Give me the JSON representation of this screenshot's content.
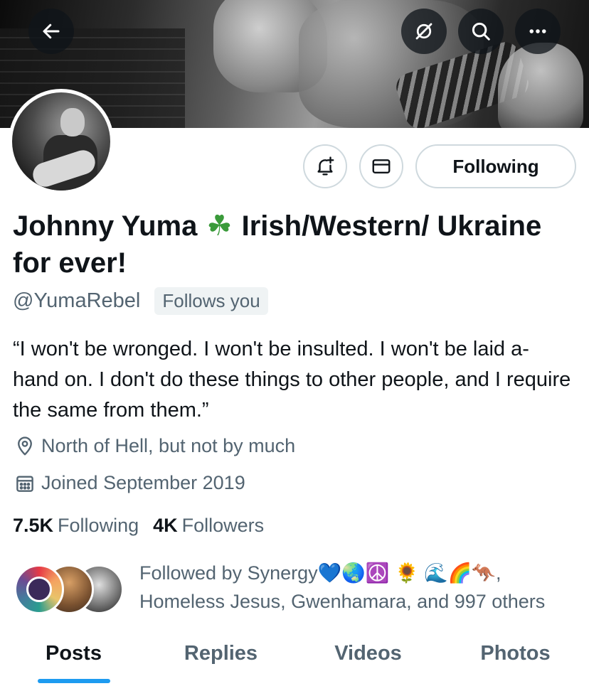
{
  "header": {
    "back_icon": "arrow-left-icon",
    "icons": [
      "no-sync-icon",
      "search-icon",
      "more-icon"
    ]
  },
  "actions": {
    "notify_icon": "bell-plus-icon",
    "message_icon": "envelope-icon",
    "following_label": "Following"
  },
  "profile": {
    "name_part1": "Johnny Yuma",
    "name_emoji": "☘",
    "name_part2": "Irish/Western/ Ukraine for ever!",
    "handle": "@YumaRebel",
    "follows_you": "Follows you",
    "bio": "“I won't be wronged. I won't be insulted. I won't be laid a-hand on. I don't do these things to other people, and I require the same from them.”",
    "location": "North of Hell, but not by much",
    "joined": "Joined September 2019",
    "following_count": "7.5K",
    "following_label": "Following",
    "followers_count": "4K",
    "followers_label": "Followers",
    "followed_by": "Followed by Synergy💙🌏☮️ 🌻 🌊🌈🦘, Homeless Jesus, Gwenhamara, and 997 others"
  },
  "tabs": [
    {
      "label": "Posts",
      "active": true
    },
    {
      "label": "Replies",
      "active": false
    },
    {
      "label": "Videos",
      "active": false
    },
    {
      "label": "Photos",
      "active": false
    }
  ],
  "colors": {
    "accent": "#1d9bf0",
    "text": "#0f1419",
    "secondary": "#536471"
  }
}
